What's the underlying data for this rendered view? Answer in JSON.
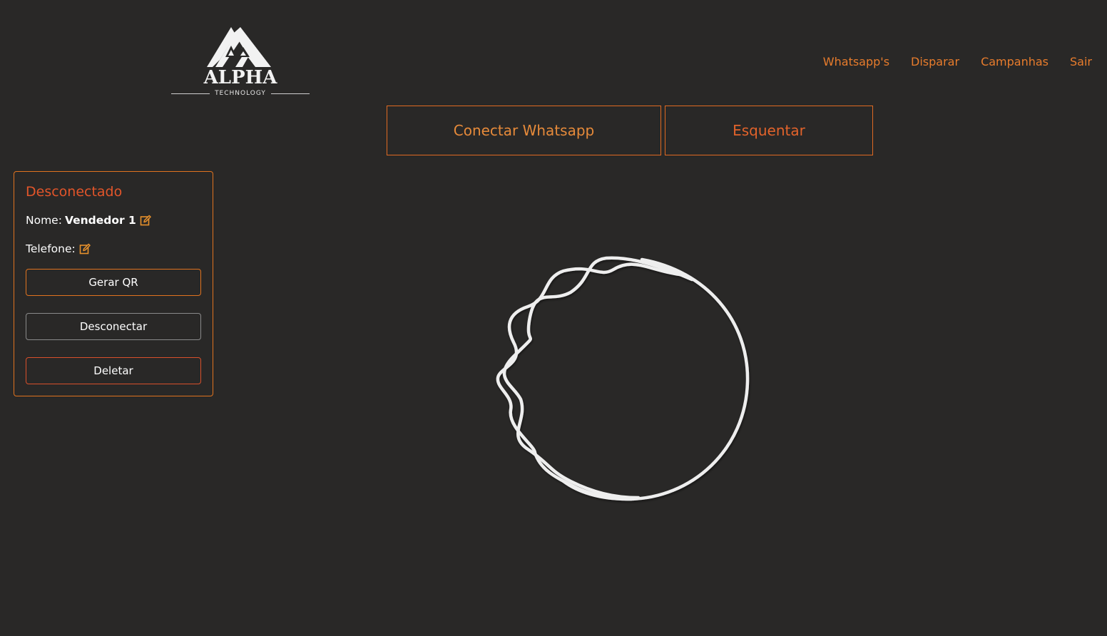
{
  "brand": {
    "title": "ALPHA",
    "subtitle": "TECHNOLOGY"
  },
  "nav": {
    "items": [
      "Whatsapp's",
      "Disparar",
      "Campanhas",
      "Sair"
    ]
  },
  "actions": {
    "connect_label": "Conectar Whatsapp",
    "warmup_label": "Esquentar"
  },
  "instance_card": {
    "status": "Desconectado",
    "name_label": "Nome:",
    "name_value": "Vendedor 1",
    "phone_label": "Telefone:",
    "phone_value": "",
    "generate_qr_label": "Gerar QR",
    "disconnect_label": "Desconectar",
    "delete_label": "Deletar"
  },
  "colors": {
    "background": "#292827",
    "accent": "#e87c2c",
    "status_red": "#e2552a",
    "spinner": "#eeeeee"
  },
  "icons": {
    "edit": "edit-icon",
    "logo": "alpha-mountain-logo"
  }
}
